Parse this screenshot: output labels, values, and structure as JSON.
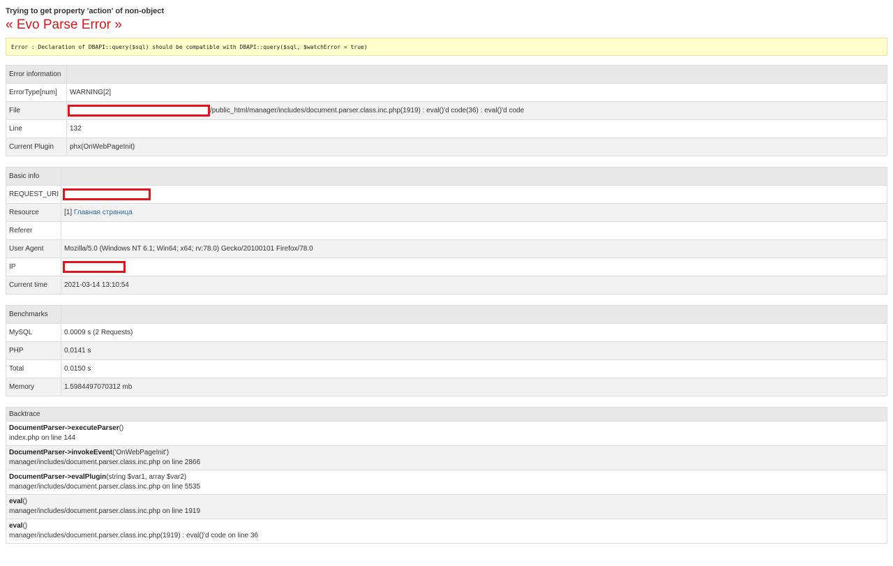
{
  "notice": "Trying to get property 'action' of non-object",
  "title": "« Evo Parse Error »",
  "error_line": "Error : Declaration of DBAPI::query($sql) should be compatible with DBAPI::query($sql, $watchError = true)",
  "error_info": {
    "header": "Error information",
    "rows": [
      {
        "label": "ErrorType[num]",
        "value": "WARNING[2]"
      },
      {
        "label": "File",
        "value": "/public_html/manager/includes/document.parser.class.inc.php(1919) : eval()'d code(36) : eval()'d code"
      },
      {
        "label": "Line",
        "value": "132"
      },
      {
        "label": "Current Plugin",
        "value": "phx(OnWebPageInit)"
      }
    ]
  },
  "basic_info": {
    "header": "Basic info",
    "rows": [
      {
        "label": "REQUEST_URI",
        "value": ""
      },
      {
        "label": "Resource",
        "value_prefix": "[1] ",
        "link": "Главная страница"
      },
      {
        "label": "Referer",
        "value": ""
      },
      {
        "label": "User Agent",
        "value": "Mozilla/5.0 (Windows NT 6.1; Win64; x64; rv:78.0) Gecko/20100101 Firefox/78.0"
      },
      {
        "label": "IP",
        "value": ""
      },
      {
        "label": "Current time",
        "value": "2021-03-14 13:10:54"
      }
    ]
  },
  "benchmarks": {
    "header": "Benchmarks",
    "rows": [
      {
        "label": "MySQL",
        "value": "0.0009 s (2 Requests)"
      },
      {
        "label": "PHP",
        "value": "0.0141 s"
      },
      {
        "label": "Total",
        "value": "0.0150 s"
      },
      {
        "label": "Memory",
        "value": "1.5984497070312 mb"
      }
    ]
  },
  "backtrace": {
    "header": "Backtrace",
    "items": [
      {
        "fn": "DocumentParser->executeParser",
        "args": "()",
        "loc": "index.php on line 144"
      },
      {
        "fn": "DocumentParser->invokeEvent",
        "args": "('OnWebPageInit')",
        "loc": "manager/includes/document.parser.class.inc.php on line 2866"
      },
      {
        "fn": "DocumentParser->evalPlugin",
        "args": "(string $var1, array $var2)",
        "loc": "manager/includes/document.parser.class.inc.php on line 5535"
      },
      {
        "fn": "eval",
        "args": "()",
        "loc": "manager/includes/document.parser.class.inc.php on line 1919"
      },
      {
        "fn": "eval",
        "args": "()",
        "loc": "manager/includes/document.parser.class.inc.php(1919) : eval()'d code on line 36"
      }
    ]
  }
}
